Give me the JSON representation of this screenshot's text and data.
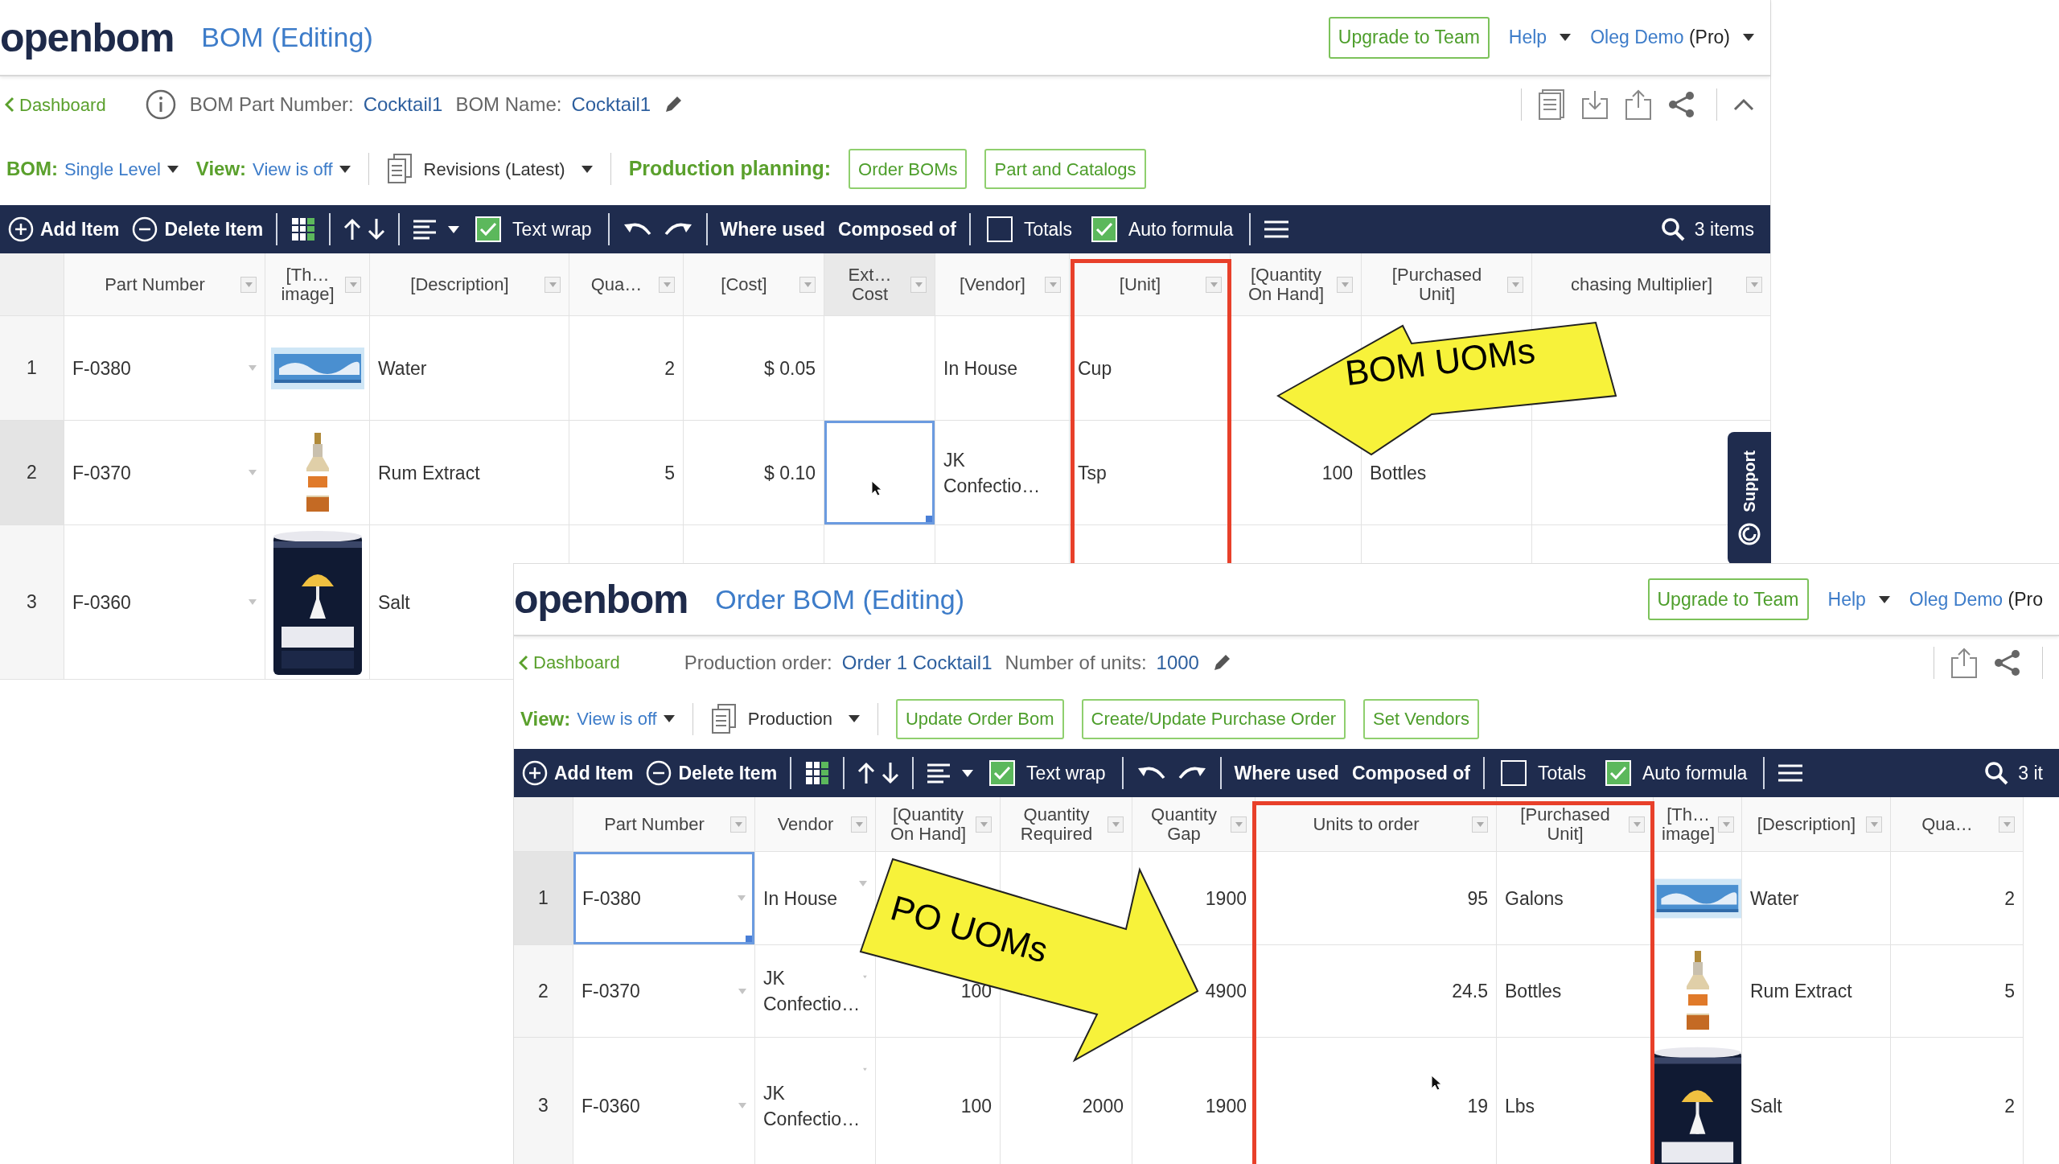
{
  "bom_window": {
    "logo": "openbom",
    "title": "BOM (Editing)",
    "upgrade": "Upgrade to Team",
    "help": "Help",
    "user": {
      "name": "Oleg Demo",
      "plan": "(Pro)",
      "caret": true
    },
    "nav": {
      "back_link": "Dashboard",
      "info": true,
      "fields": [
        {
          "label": "BOM Part Number:",
          "value": "Cocktail1"
        },
        {
          "label": "BOM Name:",
          "value": "Cocktail1"
        }
      ],
      "editable": true,
      "actions": [
        {
          "kind": "document"
        },
        {
          "kind": "download"
        },
        {
          "kind": "upload"
        },
        {
          "kind": "share"
        }
      ],
      "collapse": true
    },
    "planning": [
      {
        "kind": "select",
        "label": "BOM:",
        "value": "Single Level"
      },
      {
        "kind": "select",
        "label": "View:",
        "value": "View is off"
      },
      {
        "kind": "separator"
      },
      {
        "kind": "doc_select",
        "value": "Revisions (Latest)"
      },
      {
        "kind": "separator"
      },
      {
        "kind": "heading",
        "text": "Production planning:"
      },
      {
        "kind": "button",
        "text": "Order BOMs"
      },
      {
        "kind": "button",
        "text": "Part and Catalogs"
      }
    ],
    "toolbar": [
      {
        "kind": "add",
        "label": "Add Item"
      },
      {
        "kind": "delete",
        "label": "Delete Item"
      },
      {
        "kind": "separator"
      },
      {
        "kind": "grid"
      },
      {
        "kind": "separator"
      },
      {
        "kind": "move"
      },
      {
        "kind": "separator"
      },
      {
        "kind": "align"
      },
      {
        "kind": "checkbox",
        "label": "Text wrap",
        "checked": true
      },
      {
        "kind": "separator"
      },
      {
        "kind": "undo"
      },
      {
        "kind": "redo"
      },
      {
        "kind": "separator"
      },
      {
        "kind": "text_button",
        "label": "Where used"
      },
      {
        "kind": "text_button",
        "label": "Composed of"
      },
      {
        "kind": "separator"
      },
      {
        "kind": "checkbox",
        "label": "Totals",
        "checked": false
      },
      {
        "kind": "checkbox",
        "label": "Auto formula",
        "checked": true
      },
      {
        "kind": "separator"
      },
      {
        "kind": "menu"
      },
      {
        "kind": "search",
        "label": "3 items"
      }
    ],
    "table": {
      "columns": [
        {
          "label": "Part Number",
          "kind": "part",
          "dimmed": false
        },
        {
          "label": "[Th…\nimage]",
          "kind": "picture",
          "dimmed": false
        },
        {
          "label": "[Description]",
          "kind": "text",
          "dimmed": false
        },
        {
          "label": "Qua…",
          "kind": "number",
          "dimmed": false
        },
        {
          "label": "[Cost]",
          "kind": "number",
          "dimmed": false
        },
        {
          "label": "Ext…\nCost",
          "kind": "number",
          "dimmed": true
        },
        {
          "label": "[Vendor]",
          "kind": "text",
          "dimmed": false
        },
        {
          "label": "[Unit]",
          "kind": "text",
          "dimmed": false
        },
        {
          "label": "[Quantity\nOn Hand]",
          "kind": "number",
          "dimmed": false
        },
        {
          "label": "[Purchased\nUnit]",
          "kind": "text",
          "dimmed": false
        },
        {
          "label": "chasing Multiplier]",
          "kind": "number",
          "dimmed": false
        }
      ],
      "rows": [
        {
          "number": "1",
          "selected": false,
          "ext_cost_focused": false,
          "part_number": "F-0380",
          "description": "Water",
          "quantity": "2",
          "cost": "$ 0.05",
          "vendor": "In House",
          "unit": "Cup"
        },
        {
          "number": "2",
          "selected": true,
          "ext_cost_focused": true,
          "part_number": "F-0370",
          "description": "Rum Extract",
          "quantity": "5",
          "cost": "$ 0.10",
          "vendor": "JK Confectio…",
          "unit": "Tsp",
          "on_hand": "100",
          "purchased_unit": "Bottles"
        },
        {
          "number": "3",
          "selected": false,
          "ext_cost_focused": false,
          "part_number": "F-0360",
          "description": "Salt"
        }
      ]
    },
    "support_tab": "Support"
  },
  "order_window": {
    "logo": "openbom",
    "title": "Order BOM (Editing)",
    "upgrade": "Upgrade to Team",
    "help": "Help",
    "user": {
      "name": "Oleg Demo",
      "plan": "(Pro",
      "caret": false
    },
    "nav": {
      "back_link": "Dashboard",
      "info": false,
      "fields": [
        {
          "label": "Production order:",
          "value": "Order 1 Cocktail1"
        },
        {
          "label": "Number of units:",
          "value": "1000"
        }
      ],
      "editable": true,
      "actions": [
        {
          "kind": "upload"
        },
        {
          "kind": "share"
        }
      ],
      "collapse": false
    },
    "planning": [
      {
        "kind": "select",
        "label": "View:",
        "value": "View is off"
      },
      {
        "kind": "separator"
      },
      {
        "kind": "doc_select",
        "value": "Production"
      },
      {
        "kind": "separator"
      },
      {
        "kind": "button",
        "text": "Update Order Bom"
      },
      {
        "kind": "button",
        "text": "Create/Update Purchase Order"
      },
      {
        "kind": "button",
        "text": "Set Vendors"
      }
    ],
    "toolbar": [
      {
        "kind": "add",
        "label": "Add Item"
      },
      {
        "kind": "delete",
        "label": "Delete Item"
      },
      {
        "kind": "separator"
      },
      {
        "kind": "grid"
      },
      {
        "kind": "separator"
      },
      {
        "kind": "move"
      },
      {
        "kind": "separator"
      },
      {
        "kind": "align"
      },
      {
        "kind": "checkbox",
        "label": "Text wrap",
        "checked": true
      },
      {
        "kind": "separator"
      },
      {
        "kind": "undo"
      },
      {
        "kind": "redo"
      },
      {
        "kind": "separator"
      },
      {
        "kind": "text_button",
        "label": "Where used"
      },
      {
        "kind": "text_button",
        "label": "Composed of"
      },
      {
        "kind": "separator"
      },
      {
        "kind": "checkbox",
        "label": "Totals",
        "checked": false
      },
      {
        "kind": "checkbox",
        "label": "Auto formula",
        "checked": true
      },
      {
        "kind": "separator"
      },
      {
        "kind": "menu"
      },
      {
        "kind": "search",
        "label": "3 it"
      }
    ],
    "table": {
      "columns": [
        {
          "label": "Part Number",
          "kind": "part",
          "dimmed": false
        },
        {
          "label": "Vendor",
          "kind": "dropdown",
          "dimmed": false
        },
        {
          "label": "[Quantity\nOn Hand]",
          "kind": "number",
          "dimmed": false
        },
        {
          "label": "Quantity\nRequired",
          "kind": "number",
          "dimmed": false
        },
        {
          "label": "Quantity\nGap",
          "kind": "number",
          "dimmed": false
        },
        {
          "label": "Units to order",
          "kind": "number",
          "dimmed": false
        },
        {
          "label": "[Purchased\nUnit]",
          "kind": "text",
          "dimmed": false
        },
        {
          "label": "[Th…\nimage]",
          "kind": "picture",
          "dimmed": false
        },
        {
          "label": "[Description]",
          "kind": "text",
          "dimmed": false
        },
        {
          "label": "Qua…",
          "kind": "number",
          "dimmed": false
        }
      ],
      "rows": [
        {
          "number": "1",
          "selected": true,
          "part_number_focused": true,
          "part_number": "F-0380",
          "vendor": "In House",
          "gap": "1900",
          "units_to_order": "95",
          "purchased_unit": "Galons",
          "description": "Water",
          "quantity": "2"
        },
        {
          "number": "2",
          "selected": false,
          "part_number_focused": false,
          "part_number": "F-0370",
          "vendor": "JK Confectio…",
          "on_hand": "100",
          "gap": "4900",
          "units_to_order": "24.5",
          "purchased_unit": "Bottles",
          "description": "Rum Extract",
          "quantity": "5"
        },
        {
          "number": "3",
          "selected": false,
          "part_number_focused": false,
          "part_number": "F-0360",
          "vendor": "JK Confectio…",
          "on_hand": "100",
          "required": "2000",
          "gap": "1900",
          "units_to_order": "19",
          "purchased_unit": "Lbs",
          "description": "Salt",
          "quantity": "2"
        }
      ]
    }
  },
  "callouts": [
    {
      "text": "BOM UOMs"
    },
    {
      "text": "PO UOMs"
    }
  ]
}
